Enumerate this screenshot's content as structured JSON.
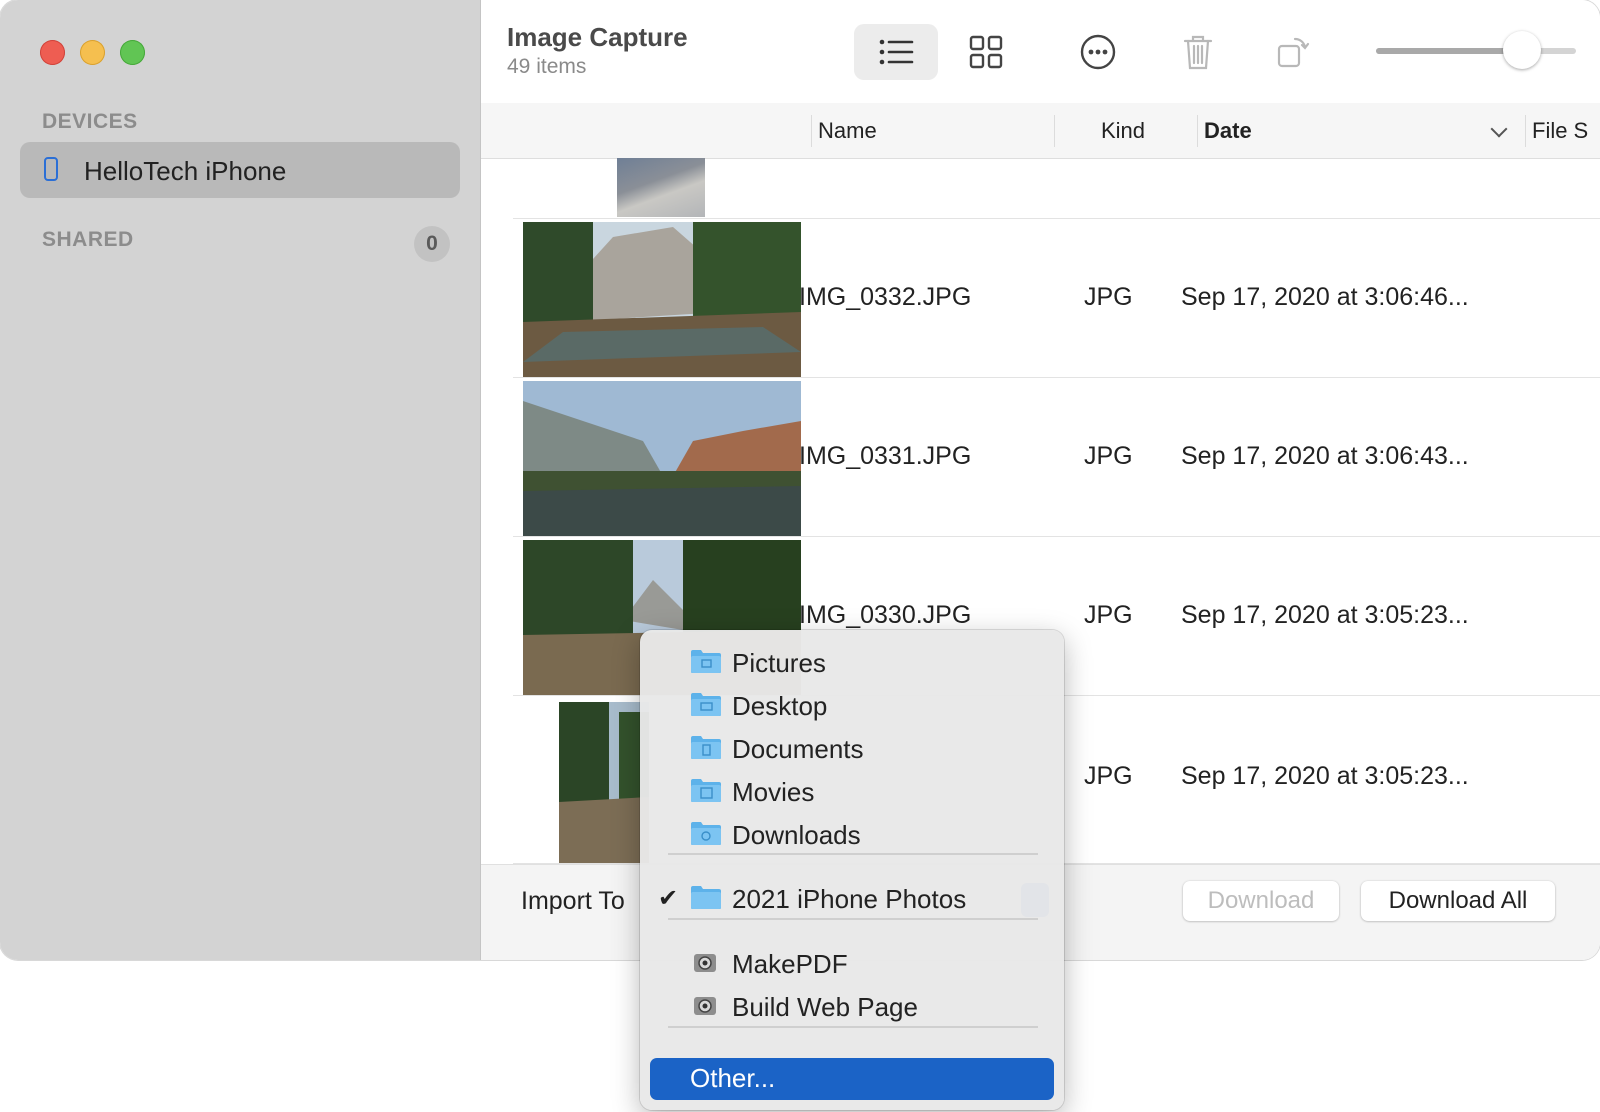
{
  "sidebar": {
    "devices_heading": "DEVICES",
    "device_name": "HelloTech iPhone",
    "shared_heading": "SHARED",
    "shared_count": "0"
  },
  "toolbar": {
    "title": "Image Capture",
    "subtitle": "49 items",
    "icons": [
      "list-view-icon",
      "grid-view-icon",
      "more-icon",
      "trash-icon",
      "rotate-icon"
    ],
    "thumbnail_size_fraction": 0.73
  },
  "table": {
    "columns": [
      "Name",
      "Kind",
      "Date",
      "File S"
    ],
    "sort_column": "Date",
    "rows": [
      {
        "name": "",
        "kind": "",
        "date": ""
      },
      {
        "name": "IMG_0332.JPG",
        "kind": "JPG",
        "date": "Sep 17, 2020 at 3:06:46..."
      },
      {
        "name": "IMG_0331.JPG",
        "kind": "JPG",
        "date": "Sep 17, 2020 at 3:06:43..."
      },
      {
        "name": "IMG_0330.JPG",
        "kind": "JPG",
        "date": "Sep 17, 2020 at 3:05:23..."
      },
      {
        "name": "",
        "kind": "JPG",
        "date": "Sep 17, 2020 at 3:05:23..."
      }
    ]
  },
  "bottom": {
    "import_label": "Import To",
    "download_label": "Download",
    "download_all_label": "Download All"
  },
  "menu": {
    "folders": [
      {
        "label": "Pictures",
        "icon": "folder-pictures-icon"
      },
      {
        "label": "Desktop",
        "icon": "folder-desktop-icon"
      },
      {
        "label": "Documents",
        "icon": "folder-documents-icon"
      },
      {
        "label": "Movies",
        "icon": "folder-movies-icon"
      },
      {
        "label": "Downloads",
        "icon": "folder-downloads-icon"
      }
    ],
    "selected_folder": "2021 iPhone Photos",
    "apps": [
      "MakePDF",
      "Build Web Page"
    ],
    "other": "Other...",
    "highlight_color": "#1b63c6"
  },
  "colors": {
    "close": "#ee5d52",
    "minimize": "#f5bf4f",
    "zoom": "#61c554",
    "folder": "#5db2ea"
  }
}
